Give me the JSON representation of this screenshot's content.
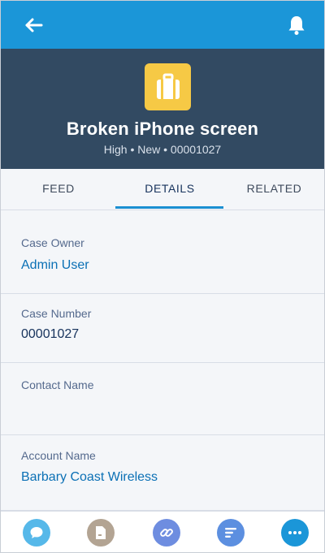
{
  "header": {
    "title": "Broken iPhone screen",
    "subtitle": "High • New • 00001027"
  },
  "tabs": [
    {
      "label": "FEED",
      "active": false
    },
    {
      "label": "DETAILS",
      "active": true
    },
    {
      "label": "RELATED",
      "active": false
    }
  ],
  "fields": [
    {
      "label": "Case Owner",
      "value": "Admin User",
      "is_link": true
    },
    {
      "label": "Case Number",
      "value": "00001027",
      "is_link": false
    },
    {
      "label": "Contact Name",
      "value": "",
      "is_link": false
    },
    {
      "label": "Account Name",
      "value": "Barbary Coast Wireless",
      "is_link": true
    }
  ],
  "actions": [
    {
      "icon": "chat-bubble-icon",
      "color": "#56b8e9"
    },
    {
      "icon": "document-icon",
      "color": "#b3a493"
    },
    {
      "icon": "link-icon",
      "color": "#6e8de0"
    },
    {
      "icon": "lines-icon",
      "color": "#5c8fe0"
    },
    {
      "icon": "more-icon",
      "color": "#1b96d8"
    }
  ],
  "colors": {
    "top_bar": "#1b96d8",
    "header_bg": "#324a62",
    "case_icon_bg": "#f6c945",
    "link": "#0b70b5",
    "tab_indicator": "#1b8fd2"
  }
}
